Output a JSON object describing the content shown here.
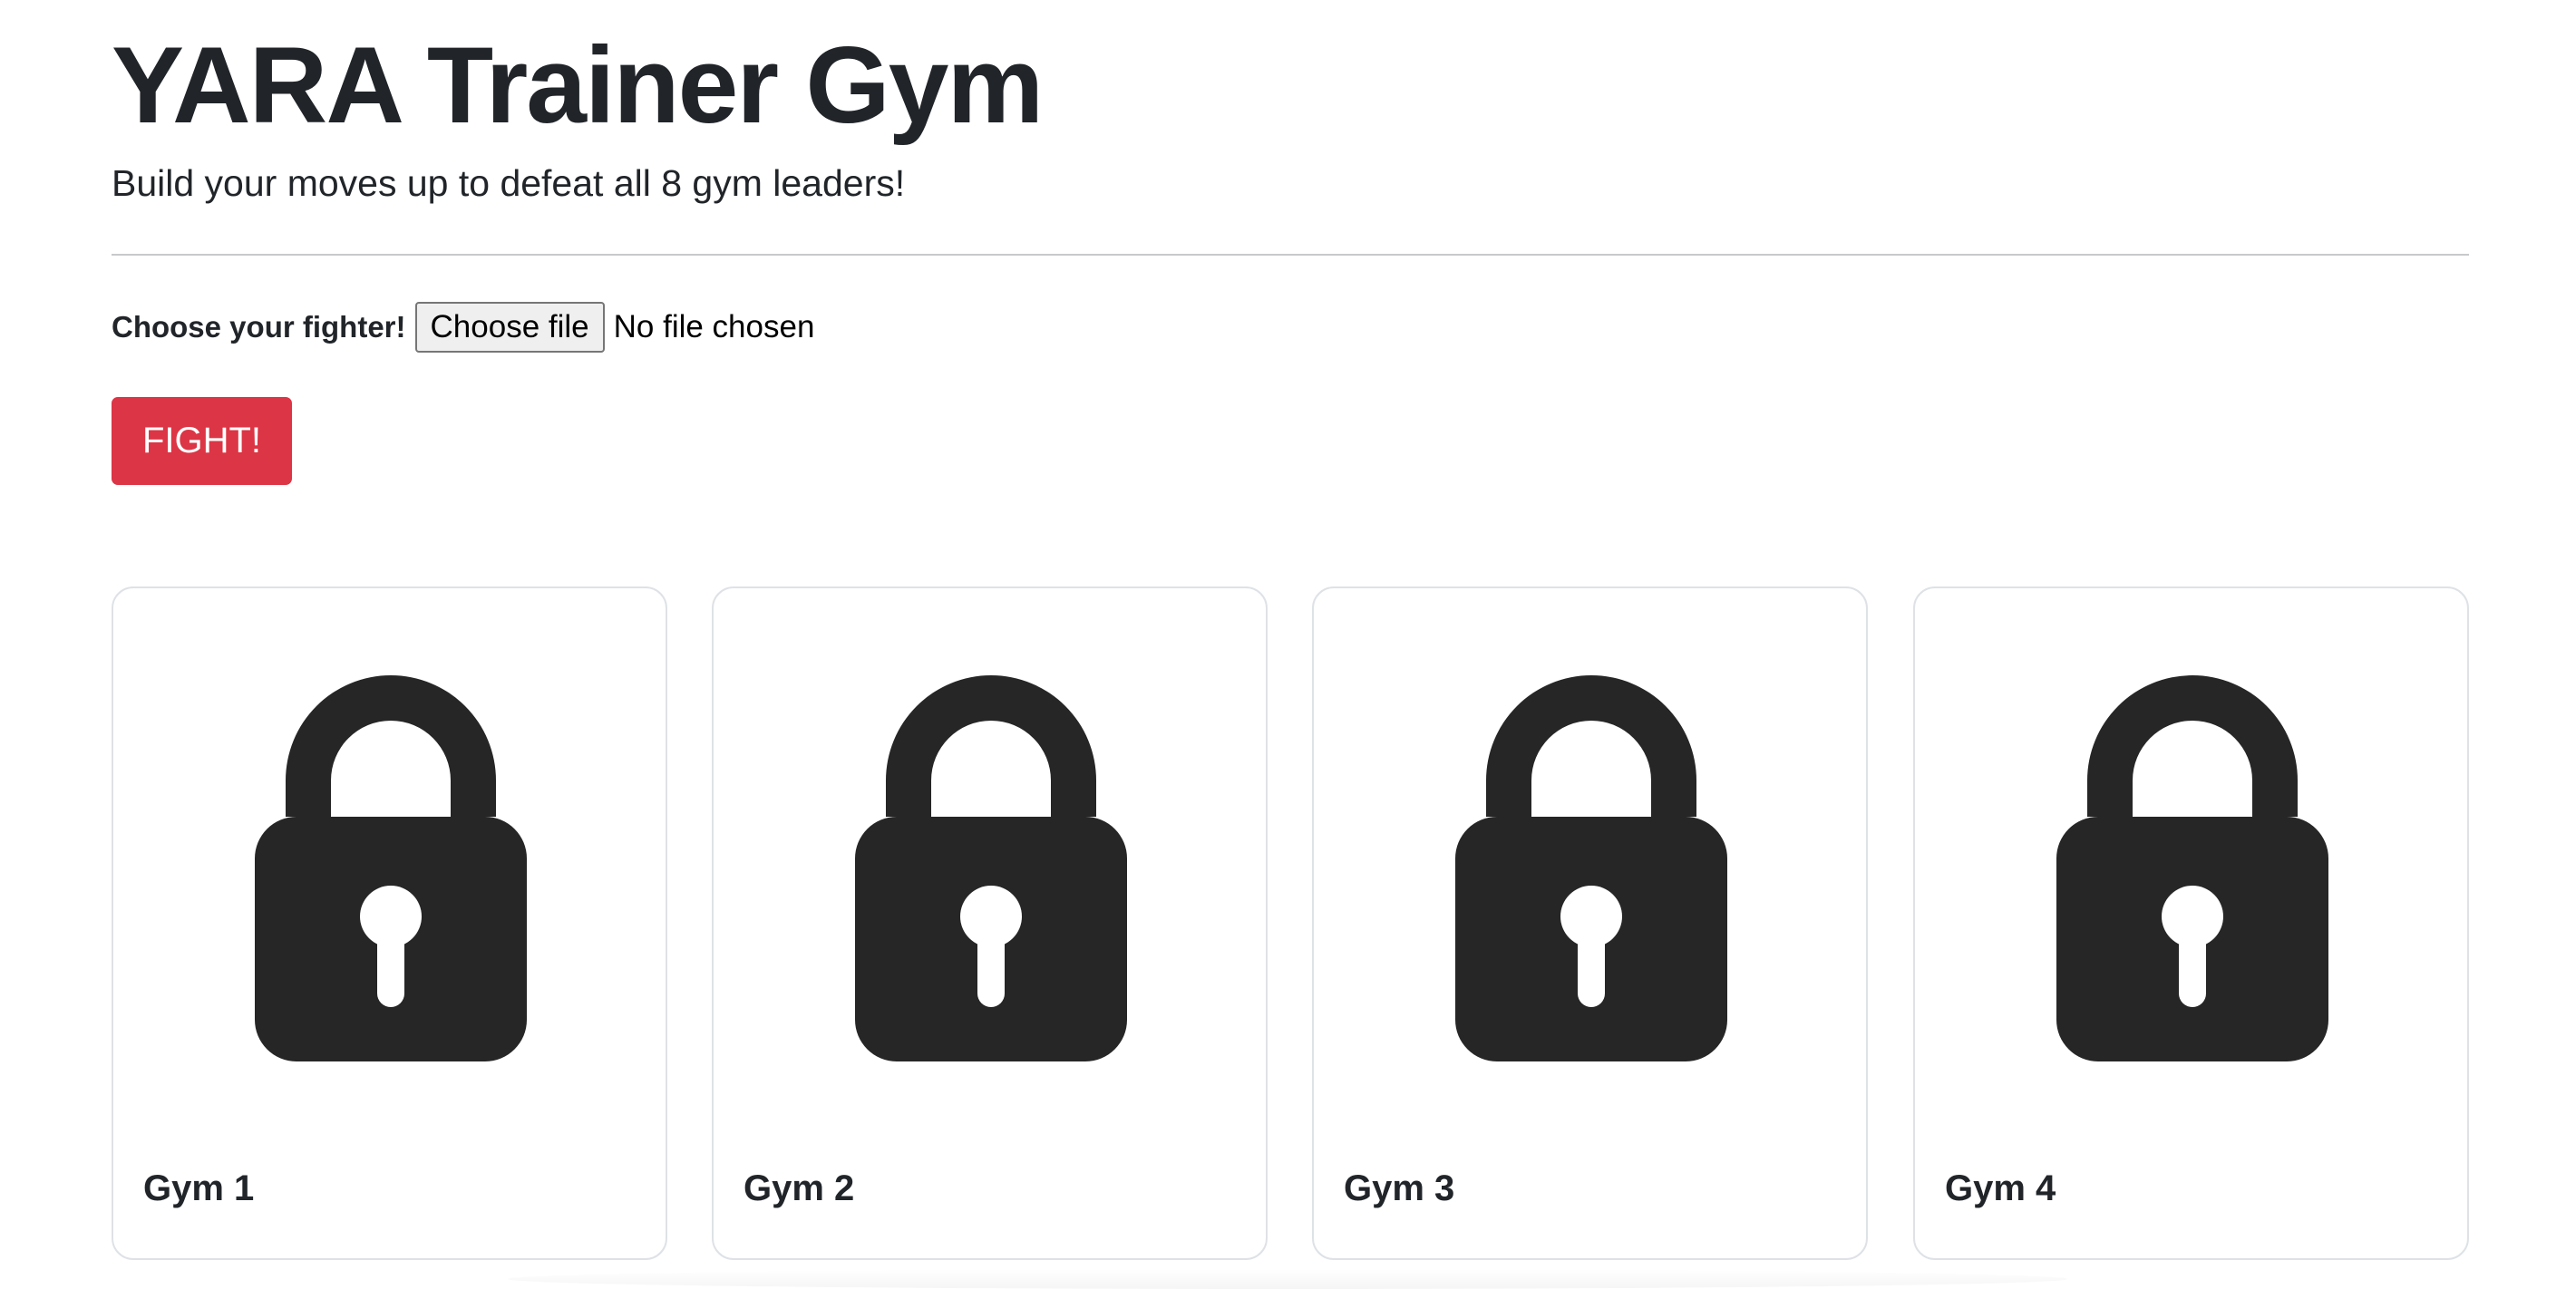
{
  "header": {
    "title": "YARA Trainer Gym",
    "subtitle": "Build your moves up to defeat all 8 gym leaders!"
  },
  "fighter": {
    "label": "Choose your fighter!",
    "file_button_label": "Choose file",
    "file_status": "No file chosen"
  },
  "fight_button": {
    "label": "FIGHT!",
    "color": "#dc3545"
  },
  "gyms": [
    {
      "name": "Gym 1",
      "icon": "lock-icon"
    },
    {
      "name": "Gym 2",
      "icon": "lock-icon"
    },
    {
      "name": "Gym 3",
      "icon": "lock-icon"
    },
    {
      "name": "Gym 4",
      "icon": "lock-icon"
    }
  ]
}
